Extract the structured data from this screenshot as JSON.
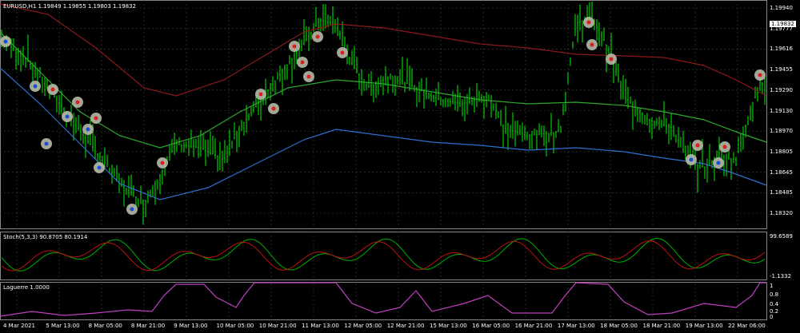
{
  "main": {
    "header": "EURUSD,H1  1.19849 1.19855 1.19803 1.19832",
    "current_price": "1.19832",
    "price_ticks": [
      "1.19940",
      "1.19777",
      "1.19616",
      "1.19455",
      "1.19290",
      "1.19130",
      "1.18970",
      "1.18805",
      "1.18645",
      "1.18485",
      "1.18320"
    ]
  },
  "stoch": {
    "label": "Stoch(5,3,3) 90.8705 80.1914",
    "top_value": "99.6589",
    "bottom_value": "-1.1332"
  },
  "laguerre": {
    "label": "Laguerre 1.0000",
    "ticks": [
      "1",
      "0.8",
      "0.4",
      "0.2",
      "0"
    ]
  },
  "time_axis": [
    "4 Mar 2021",
    "5 Mar 13:00",
    "8 Mar 05:00",
    "8 Mar 21:00",
    "9 Mar 13:00",
    "10 Mar 05:00",
    "10 Mar 21:00",
    "11 Mar 13:00",
    "12 Mar 05:00",
    "12 Mar 21:00",
    "15 Mar 13:00",
    "16 Mar 05:00",
    "16 Mar 21:00",
    "17 Mar 13:00",
    "18 Mar 05:00",
    "18 Mar 21:00",
    "19 Mar 13:00",
    "22 Mar 06:00"
  ],
  "colors": {
    "bars": "#00cc00",
    "ma_slow": "#8b1a1a",
    "ma_mid": "#2ea82e",
    "ma_fast": "#2e6fd1",
    "stoch_main": "#00b000",
    "stoch_signal": "#c01010",
    "laguerre": "#c040c0",
    "grid": "#3a4a3a"
  }
}
